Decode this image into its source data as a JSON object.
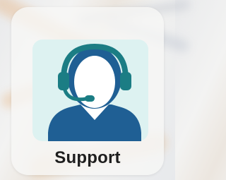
{
  "app": {
    "label": "Support",
    "icon": "customer-support-headset-icon"
  },
  "colors": {
    "icon_background": "#ddf2f1",
    "figure": "#1f5f94",
    "headset": "#1b7d84",
    "label_text": "#1e1e1e"
  }
}
